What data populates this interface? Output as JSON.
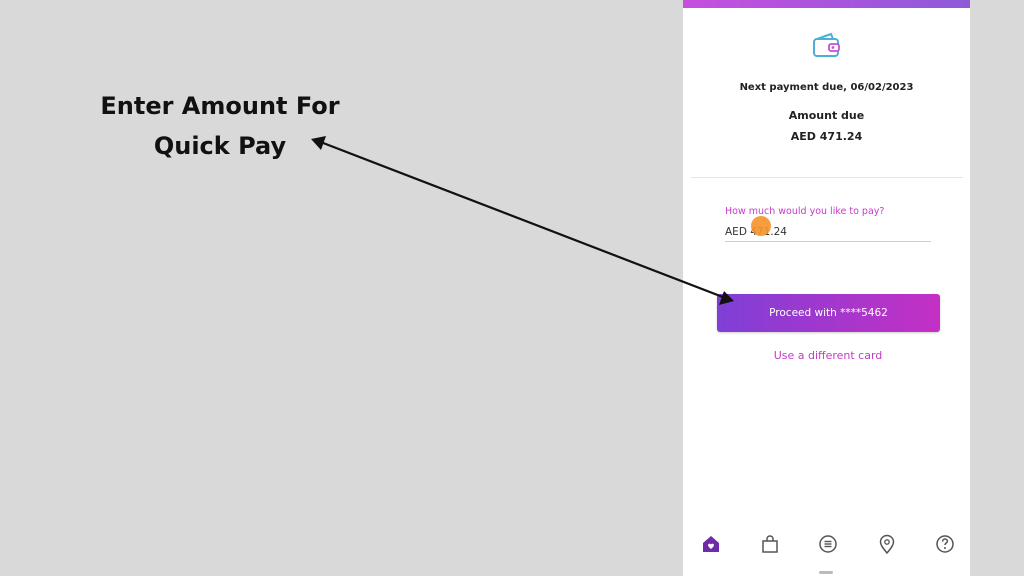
{
  "annotation": {
    "line1": "Enter Amount For",
    "line2": "Quick Pay"
  },
  "payment": {
    "next_due": "Next payment due, 06/02/2023",
    "amount_due_label": "Amount due",
    "amount_due_value": "AED 471.24"
  },
  "pay_field": {
    "label": "How much would you like to pay?",
    "value": "AED 471.24"
  },
  "actions": {
    "proceed_label": "Proceed with ****5462",
    "different_card_label": "Use a different card"
  },
  "bottom_nav": {
    "items": [
      {
        "icon": "home-icon",
        "active": true
      },
      {
        "icon": "shopping-bag-icon",
        "active": false
      },
      {
        "icon": "menu-icon",
        "active": false
      },
      {
        "icon": "location-pin-icon",
        "active": false
      },
      {
        "icon": "help-icon",
        "active": false
      }
    ]
  },
  "colors": {
    "accent_purple": "#7f3fd6",
    "accent_pink": "#c430c4",
    "link_pink": "#c43ac8",
    "background": "#d9d9d9"
  }
}
